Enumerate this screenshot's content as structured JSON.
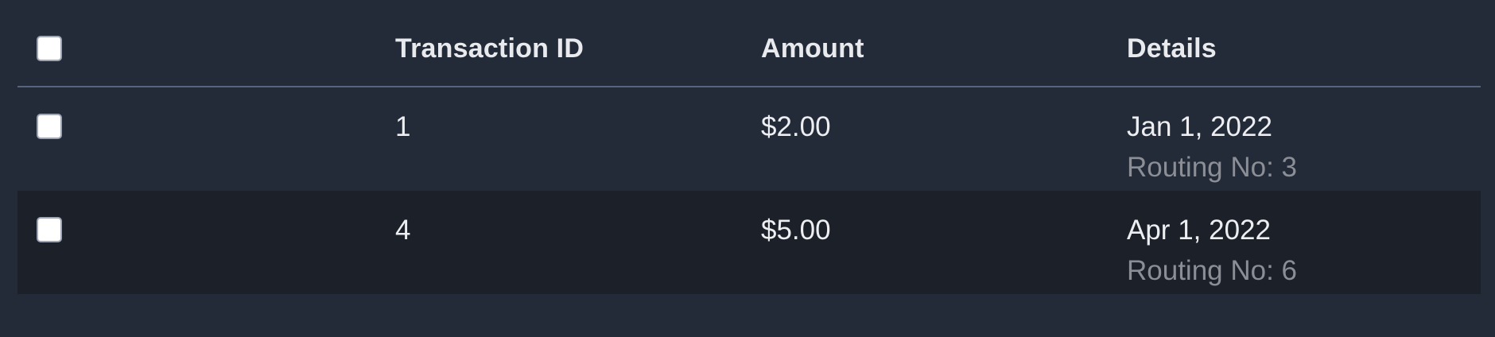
{
  "table": {
    "headers": {
      "transaction_id": "Transaction ID",
      "amount": "Amount",
      "details": "Details"
    },
    "rows": [
      {
        "id": "1",
        "amount": "$2.00",
        "date": "Jan 1, 2022",
        "routing": "Routing No: 3"
      },
      {
        "id": "4",
        "amount": "$5.00",
        "date": "Apr 1, 2022",
        "routing": "Routing No: 6"
      }
    ]
  },
  "colors": {
    "background": "#232a38",
    "alt_row": "#1b2029",
    "divider": "#56647d",
    "text": "#eceef2",
    "muted_text": "#8b8e95"
  }
}
